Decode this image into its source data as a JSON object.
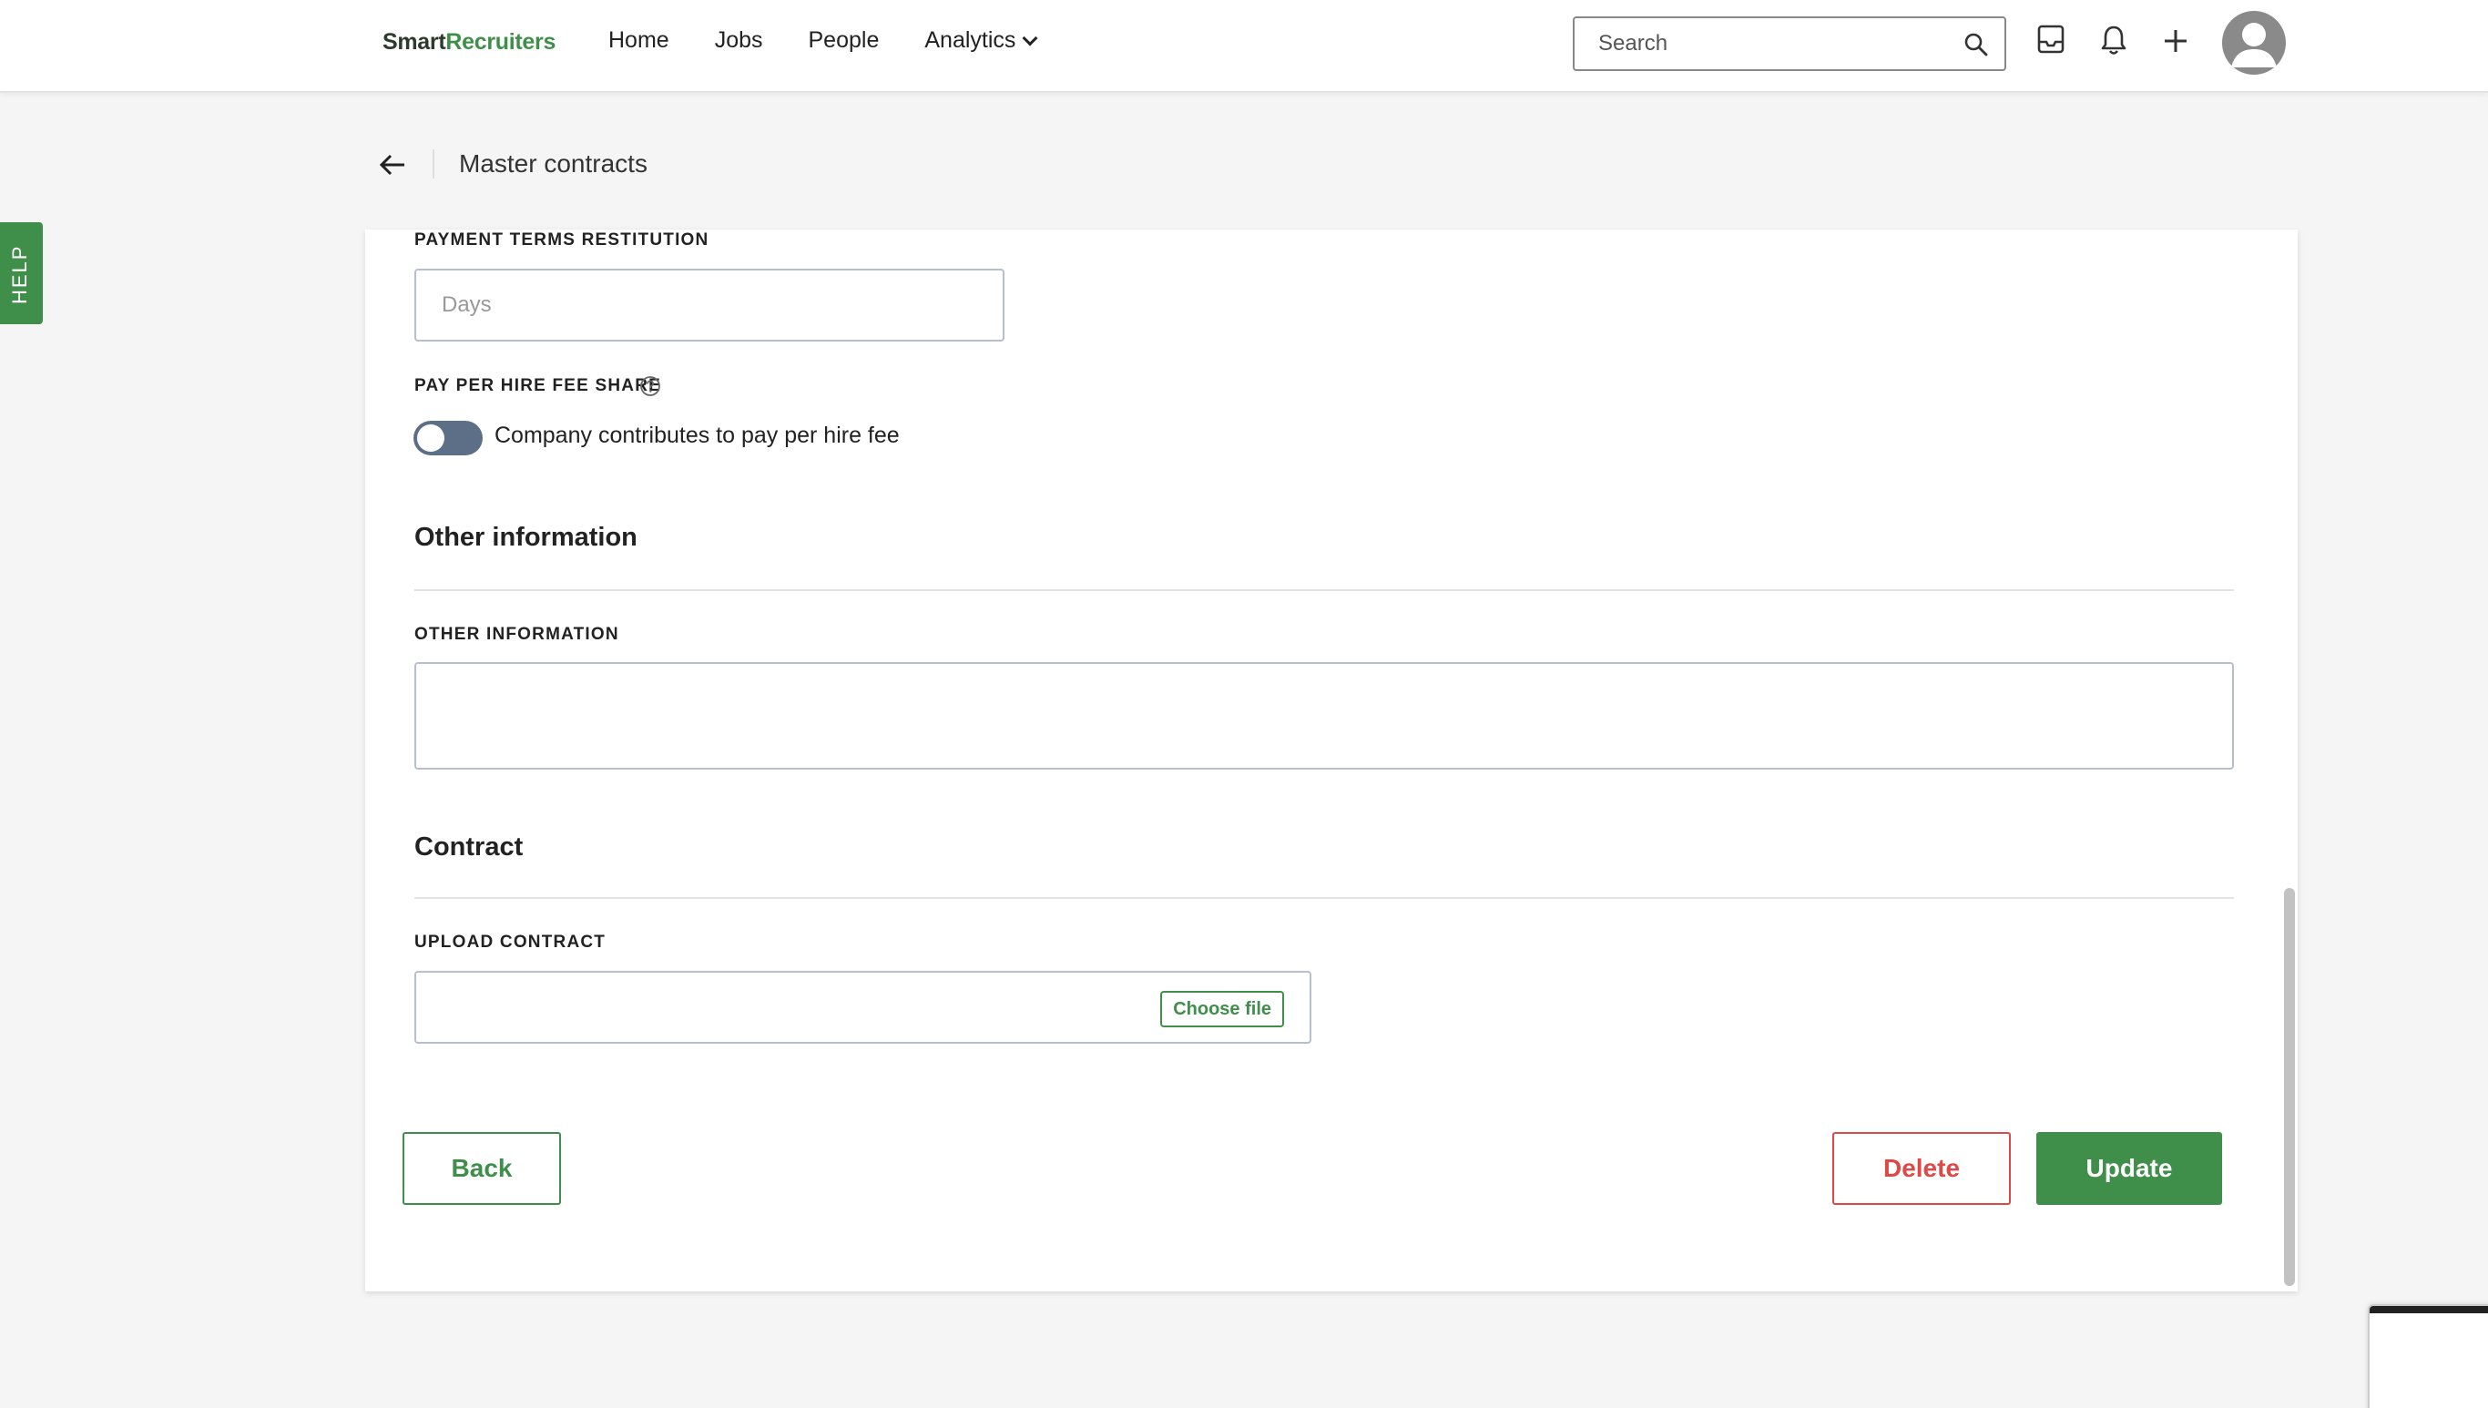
{
  "header": {
    "logo_part1": "Smart",
    "logo_part2": "Recruiters",
    "nav": [
      {
        "label": "Home"
      },
      {
        "label": "Jobs"
      },
      {
        "label": "People"
      },
      {
        "label": "Analytics"
      }
    ],
    "search_placeholder": "Search"
  },
  "help_label": "HELP",
  "page": {
    "title": "Master contracts"
  },
  "form": {
    "payment_terms_label": "PAYMENT TERMS RESTITUTION",
    "payment_terms_placeholder": "Days",
    "fee_share_label": "PAY PER HIRE FEE SHARE",
    "fee_share_toggle_text": "Company contributes to pay per hire fee",
    "fee_share_enabled": false,
    "other_info_heading": "Other information",
    "other_info_label": "OTHER INFORMATION",
    "other_info_value": "",
    "contract_heading": "Contract",
    "upload_label": "UPLOAD CONTRACT",
    "choose_file_label": "Choose file"
  },
  "actions": {
    "back": "Back",
    "delete": "Delete",
    "update": "Update"
  },
  "colors": {
    "brand_green": "#3f8f4a",
    "danger_red": "#e04848",
    "toggle_off": "#5c6f87"
  }
}
